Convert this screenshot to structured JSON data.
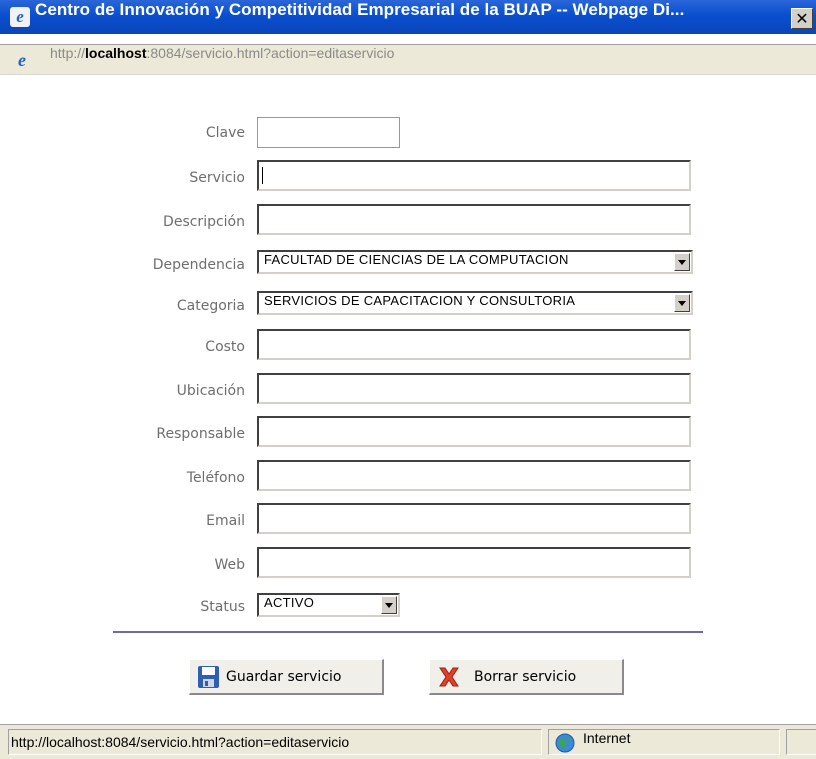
{
  "window": {
    "title": "Centro de Innovación y Competitividad Empresarial de la BUAP -- Webpage Di...",
    "close_glyph": "✕"
  },
  "address": {
    "prefix": "http://",
    "host": "localhost",
    "rest": ":8084/servicio.html?action=editaservicio"
  },
  "form": {
    "labels": {
      "clave": "Clave",
      "servicio": "Servicio",
      "descripcion": "Descripción",
      "dependencia": "Dependencia",
      "categoria": "Categoria",
      "costo": "Costo",
      "ubicacion": "Ubicación",
      "responsable": "Responsable",
      "telefono": "Teléfono",
      "email": "Email",
      "web": "Web",
      "status": "Status"
    },
    "values": {
      "clave": "",
      "servicio": "",
      "descripcion": "",
      "dependencia": "FACULTAD DE CIENCIAS DE LA COMPUTACION",
      "categoria": "SERVICIOS DE CAPACITACION Y CONSULTORIA",
      "costo": "",
      "ubicacion": "",
      "responsable": "",
      "telefono": "",
      "email": "",
      "web": "",
      "status": "ACTIVO"
    }
  },
  "buttons": {
    "save": "Guardar servicio",
    "delete": "Borrar servicio"
  },
  "statusbar": {
    "text": "http://localhost:8084/servicio.html?action=editaservicio",
    "zone": "Internet"
  },
  "icons": {
    "app": "ie-icon",
    "save": "floppy-disk-icon",
    "delete": "red-x-icon",
    "zone": "globe-icon"
  },
  "colors": {
    "titlebar": "#0a4fd0",
    "divider": "#6b6ba8"
  }
}
